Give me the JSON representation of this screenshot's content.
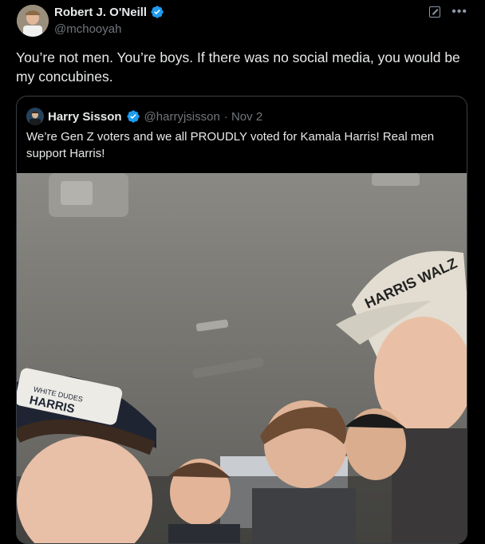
{
  "tweet": {
    "author": {
      "name": "Robert J. O'Neill",
      "handle": "@mchooyah"
    },
    "text": "You’re not men. You’re boys. If there was no social media, you would be my concubines."
  },
  "quote": {
    "author": {
      "name": "Harry Sisson",
      "handle": "@harryjsisson",
      "date": "· Nov 2"
    },
    "text": "We’re Gen Z voters and we all PROUDLY voted for Kamala Harris! Real men support Harris!"
  },
  "photo": {
    "hat_text_1": "HARRIS WALZ",
    "hat_text_2": "HARRIS",
    "hat_text_small": "WHITE DUDES"
  },
  "colors": {
    "verified": "#1d9bf0",
    "background": "#000000",
    "muted": "#71767b"
  }
}
